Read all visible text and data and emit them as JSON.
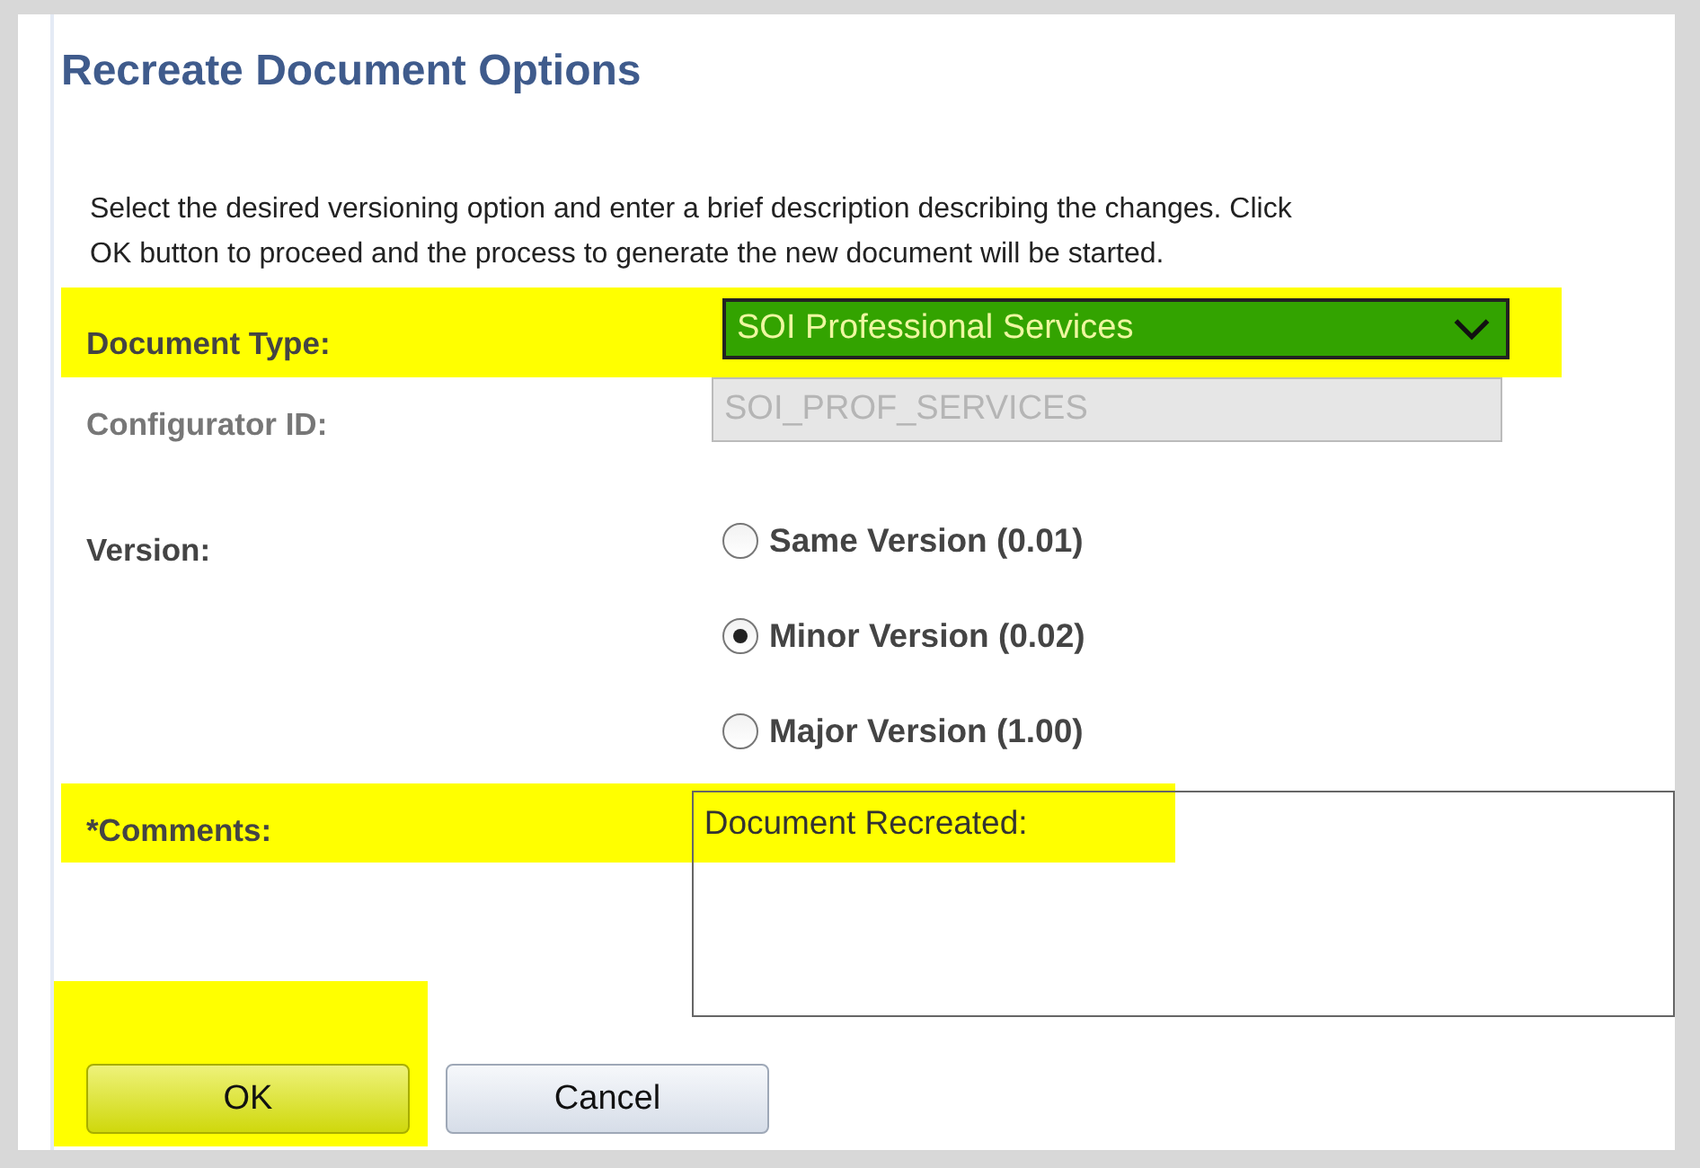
{
  "title": "Recreate Document Options",
  "instructions": [
    "Select the desired versioning option and enter a brief description describing the changes.  Click",
    "OK button to proceed and the process to generate the new document will be started."
  ],
  "document_type": {
    "label": "Document Type:",
    "value": "SOI Professional Services",
    "highlighted": true
  },
  "configurator_id": {
    "label": "Configurator ID:",
    "value": "SOI_PROF_SERVICES",
    "disabled": true
  },
  "version": {
    "label": "Version:",
    "options": [
      {
        "label": "Same Version (0.01)",
        "selected": false
      },
      {
        "label": "Minor Version (0.02)",
        "selected": true
      },
      {
        "label": "Major Version (1.00)",
        "selected": false
      }
    ]
  },
  "comments": {
    "label": "*Comments:",
    "value": "Document Recreated:",
    "highlighted": true
  },
  "buttons": [
    {
      "label": "OK",
      "kind": "primary",
      "highlighted": true
    },
    {
      "label": "Cancel",
      "kind": "secondary",
      "highlighted": false
    }
  ]
}
